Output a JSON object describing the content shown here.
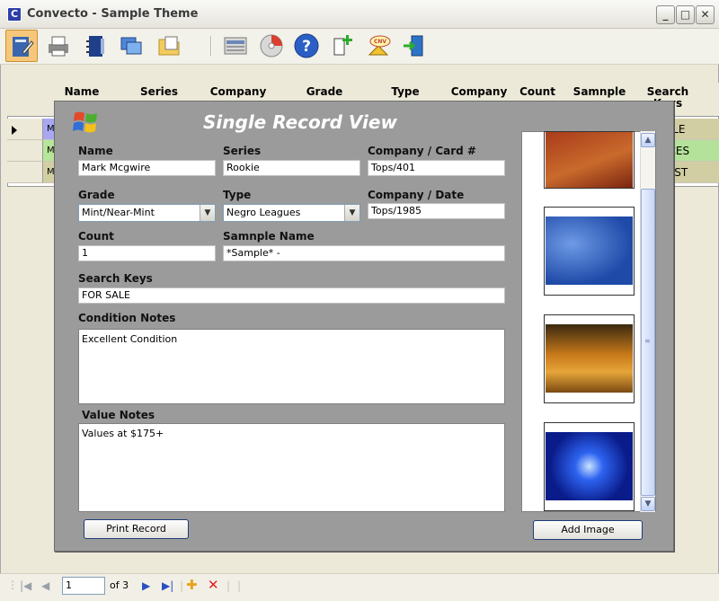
{
  "window": {
    "title": "Convecto - Sample Theme",
    "app_icon_glyph": "C"
  },
  "toolbar": {
    "icons": [
      "edit-record-icon",
      "printer-icon",
      "address-book-icon",
      "windows-icon",
      "folder-icon",
      "report-icon",
      "cd-icon",
      "help-icon",
      "add-card-icon",
      "cnv-warning-icon",
      "exit-door-icon"
    ]
  },
  "grid": {
    "headers": [
      "Name",
      "Series",
      "Company",
      "Grade",
      "Type",
      "Company",
      "Count",
      "Samnple",
      "Search Keys"
    ],
    "rows": [
      {
        "left": "M",
        "right": "ALE"
      },
      {
        "left": "M",
        "right": "ICES"
      },
      {
        "left": "M",
        "right": "LIST"
      }
    ]
  },
  "modal": {
    "title": "Single Record View",
    "fields": {
      "name": {
        "label": "Name",
        "value": "Mark Mcgwire"
      },
      "series": {
        "label": "Series",
        "value": "Rookie"
      },
      "company_card": {
        "label": "Company / Card #",
        "value": "Tops/401"
      },
      "grade": {
        "label": "Grade",
        "value": "Mint/Near-Mint"
      },
      "type": {
        "label": "Type",
        "value": "Negro Leagues"
      },
      "company_date": {
        "label": "Company / Date",
        "value": "Tops/1985"
      },
      "count": {
        "label": "Count",
        "value": "1"
      },
      "sample_name": {
        "label": "Samnple Name",
        "value": "*Sample* -"
      },
      "search_keys": {
        "label": "Search Keys",
        "value": "FOR SALE"
      },
      "condition_notes": {
        "label": "Condition Notes",
        "value": "Excellent Condition"
      },
      "value_notes": {
        "label": "Value Notes",
        "value": "Values at $175+"
      }
    },
    "print_button": "Print Record",
    "add_image_button": "Add Image",
    "thumbnails": [
      "desert-dunes-image",
      "windows-xp-blue-image",
      "autumn-path-image",
      "blue-tunnel-image"
    ],
    "thumb_colors": [
      "#b5431c",
      "#2a58b6",
      "#d68a1d",
      "#1c3ed8"
    ]
  },
  "navigator": {
    "position": "1",
    "of_text": "of 3"
  }
}
